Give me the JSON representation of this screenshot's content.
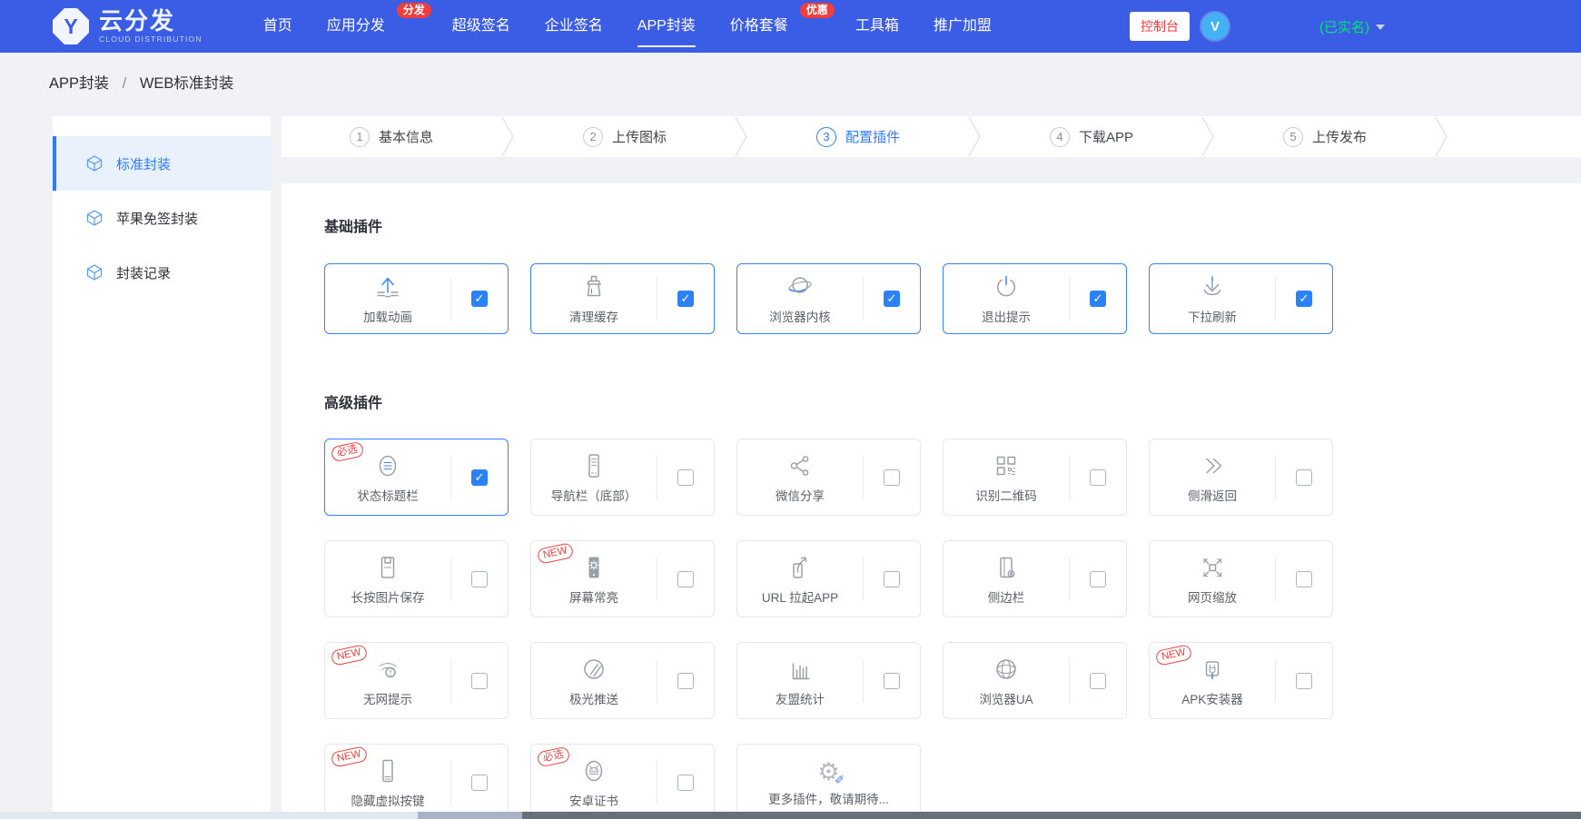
{
  "brand": {
    "logo_letter": "Y",
    "name": "云分发",
    "subtitle": "CLOUD DISTRIBUTION"
  },
  "navbar": {
    "items": [
      {
        "label": "首页",
        "active": false
      },
      {
        "label": "应用分发",
        "active": false,
        "badge": "分发"
      },
      {
        "label": "超级签名",
        "active": false
      },
      {
        "label": "企业签名",
        "active": false
      },
      {
        "label": "APP封装",
        "active": true
      },
      {
        "label": "价格套餐",
        "active": false,
        "badge": "优惠"
      },
      {
        "label": "工具箱",
        "active": false
      },
      {
        "label": "推广加盟",
        "active": false
      }
    ],
    "console_button": "控制台",
    "avatar_letter": "V",
    "verified": "(已实名)"
  },
  "breadcrumb": {
    "items": [
      "APP封装",
      "WEB标准封装"
    ],
    "separator": "/"
  },
  "sidebar": {
    "items": [
      {
        "label": "标准封装",
        "active": true
      },
      {
        "label": "苹果免签封装",
        "active": false
      },
      {
        "label": "封装记录",
        "active": false
      }
    ]
  },
  "steps": [
    {
      "num": "1",
      "label": "基本信息",
      "active": false
    },
    {
      "num": "2",
      "label": "上传图标",
      "active": false
    },
    {
      "num": "3",
      "label": "配置插件",
      "active": true
    },
    {
      "num": "4",
      "label": "下载APP",
      "active": false
    },
    {
      "num": "5",
      "label": "上传发布",
      "active": false
    }
  ],
  "plugins": {
    "basic_title": "基础插件",
    "advanced_title": "高级插件",
    "basic": [
      {
        "label": "加载动画",
        "icon": "upload-icon",
        "checked": true,
        "selected": true
      },
      {
        "label": "清理缓存",
        "icon": "brush-icon",
        "checked": true,
        "selected": true
      },
      {
        "label": "浏览器内核",
        "icon": "planet-icon",
        "checked": true,
        "selected": true
      },
      {
        "label": "退出提示",
        "icon": "power-icon",
        "checked": true,
        "selected": true
      },
      {
        "label": "下拉刷新",
        "icon": "pull-refresh-icon",
        "checked": true,
        "selected": true
      }
    ],
    "advanced": [
      [
        {
          "label": "状态标题栏",
          "badge": "必选",
          "icon": "status-bar-icon",
          "checked": true,
          "selected": true
        },
        {
          "label": "导航栏（底部）",
          "icon": "bottom-nav-icon",
          "checked": false
        },
        {
          "label": "微信分享",
          "icon": "share-icon",
          "checked": false
        },
        {
          "label": "识别二维码",
          "icon": "qr-code-icon",
          "checked": false
        },
        {
          "label": "侧滑返回",
          "icon": "double-chevron-icon",
          "checked": false
        }
      ],
      [
        {
          "label": "长按图片保存",
          "icon": "save-image-icon",
          "checked": false
        },
        {
          "label": "屏幕常亮",
          "badge": "NEW",
          "icon": "screen-on-icon",
          "checked": false
        },
        {
          "label": "URL 拉起APP",
          "icon": "url-launch-icon",
          "checked": false
        },
        {
          "label": "侧边栏",
          "icon": "sidebar-panel-icon",
          "checked": false
        },
        {
          "label": "网页缩放",
          "icon": "page-zoom-icon",
          "checked": false
        }
      ],
      [
        {
          "label": "无网提示",
          "badge": "NEW",
          "icon": "wifi-alert-icon",
          "checked": false
        },
        {
          "label": "极光推送",
          "icon": "jpush-icon",
          "checked": false
        },
        {
          "label": "友盟统计",
          "icon": "bar-chart-icon",
          "checked": false
        },
        {
          "label": "浏览器UA",
          "icon": "globe-icon",
          "checked": false
        },
        {
          "label": "APK安装器",
          "badge": "NEW",
          "icon": "apk-installer-icon",
          "checked": false
        }
      ],
      [
        {
          "label": "隐藏虚拟按键",
          "badge": "NEW",
          "icon": "virtual-keys-icon",
          "checked": false
        },
        {
          "label": "安卓证书",
          "badge": "必选",
          "icon": "android-icon",
          "checked": false
        },
        {
          "label": "更多插件，敬请期待...",
          "icon": "gear-icon",
          "more": true
        }
      ]
    ]
  },
  "colors": {
    "navbar_bg": "#3b5ce5",
    "accent_blue": "#2f7cf6",
    "badge_red": "#f23d3d",
    "success_green": "#00e573",
    "checkbox_blue": "#2b82f7",
    "page_bg": "#f0f2f5",
    "card_border": "#e5e8ee",
    "selected_border": "#3a80f7"
  }
}
